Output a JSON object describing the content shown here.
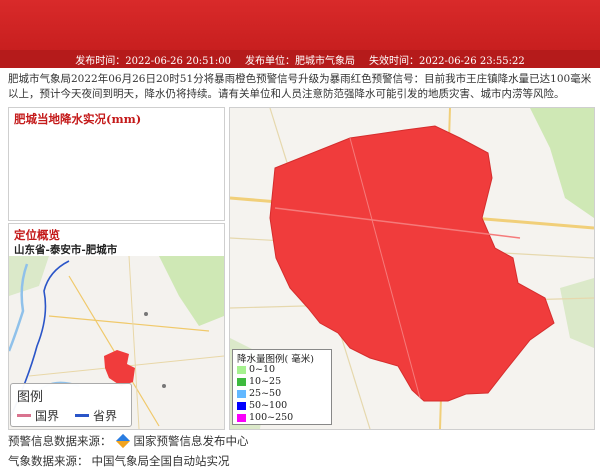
{
  "header": {
    "release_time": "发布时间：2022-06-26 20:51:00",
    "publisher": "发布单位：肥城市气象局",
    "expire_time": "失效时间：2022-06-26 23:55:22"
  },
  "description": "肥城市气象局2022年06月26日20时51分将暴雨橙色预警信号升级为暴雨红色预警信号：目前我市王庄镇降水量已达100毫米以上，预计今天夜间到明天，降水仍将持续。请有关单位和人员注意防范强降水可能引发的地质灾害、城市内涝等风险。",
  "rain_panel": {
    "title": "肥城当地降水实况(mm)"
  },
  "location_panel": {
    "title": "定位概览",
    "location": "山东省-泰安市-肥城市",
    "legend_title": "图例",
    "legend_items": [
      {
        "label": "国界",
        "color": "#d9738f"
      },
      {
        "label": "省界",
        "color": "#2a55c8"
      }
    ]
  },
  "rain_legend": {
    "title": "降水量图例( 毫米)",
    "items": [
      {
        "label": "0~10",
        "color": "#a6f28f"
      },
      {
        "label": "10~25",
        "color": "#3dba3d"
      },
      {
        "label": "25~50",
        "color": "#61b8ff"
      },
      {
        "label": "50~100",
        "color": "#0000fe"
      },
      {
        "label": "100~250",
        "color": "#fa00fa"
      }
    ]
  },
  "footer": {
    "warning_source_label": "预警信息数据来源：",
    "warning_source": "国家预警信息发布中心",
    "weather_source_label": "气象数据来源：",
    "weather_source": "中国气象局全国自动站实况"
  },
  "colors": {
    "banner": "#d92a2a",
    "infobar": "#b51b1b",
    "warning_area": "#f03c3c"
  }
}
